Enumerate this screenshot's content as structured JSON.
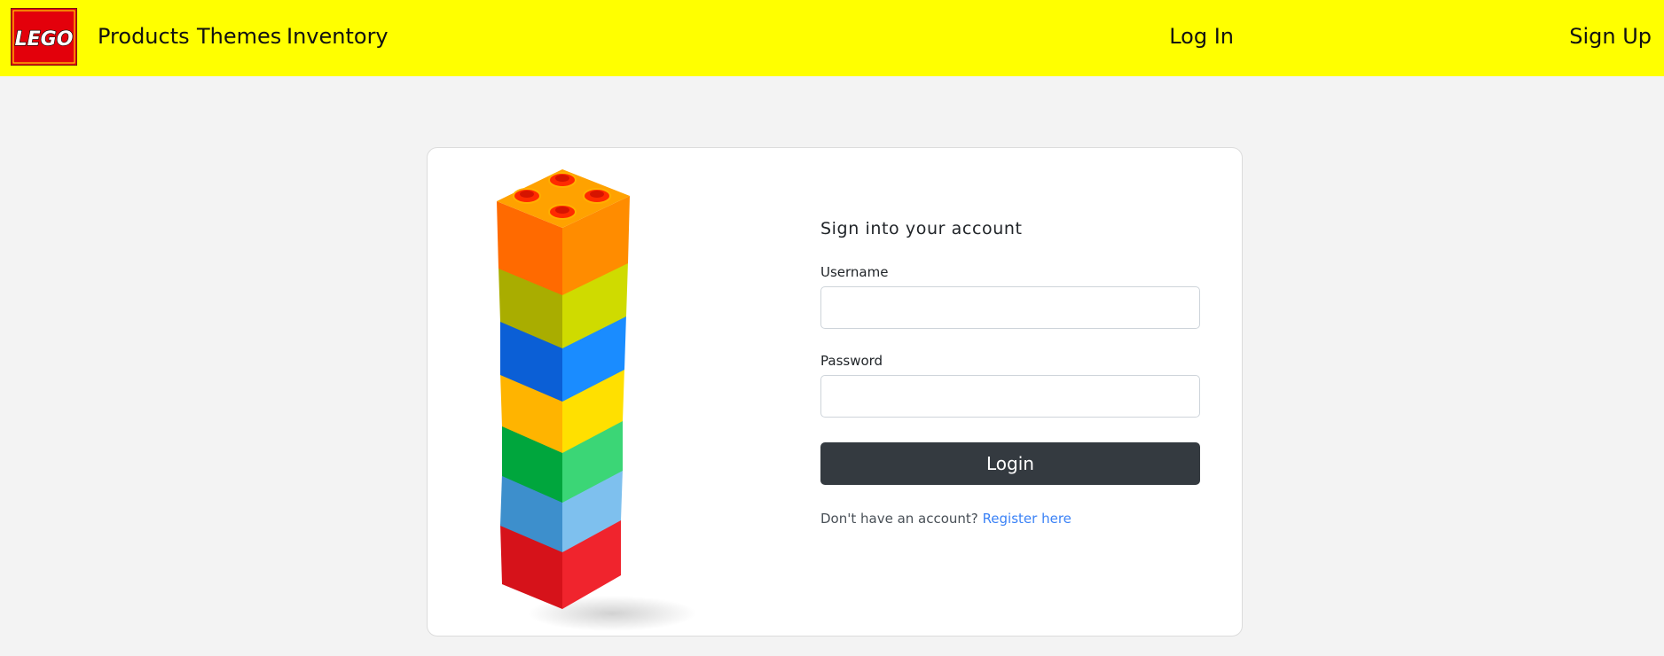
{
  "nav": {
    "brand_text": "LEGO",
    "links": {
      "products": "Products",
      "themes": "Themes",
      "inventory": "Inventory",
      "login": "Log In",
      "signup": "Sign Up"
    }
  },
  "colors": {
    "navbar_bg": "#ffff00",
    "page_bg": "#f3f3f3",
    "button_bg": "#343a40",
    "link": "#3b82f6"
  },
  "form": {
    "title": "Sign into your account",
    "username_label": "Username",
    "username_value": "",
    "password_label": "Password",
    "password_value": "",
    "submit_label": "Login",
    "no_account_text": "Don't have an account?",
    "register_link": "Register here"
  },
  "image": {
    "description_icon": "stacked-bricks-image"
  }
}
